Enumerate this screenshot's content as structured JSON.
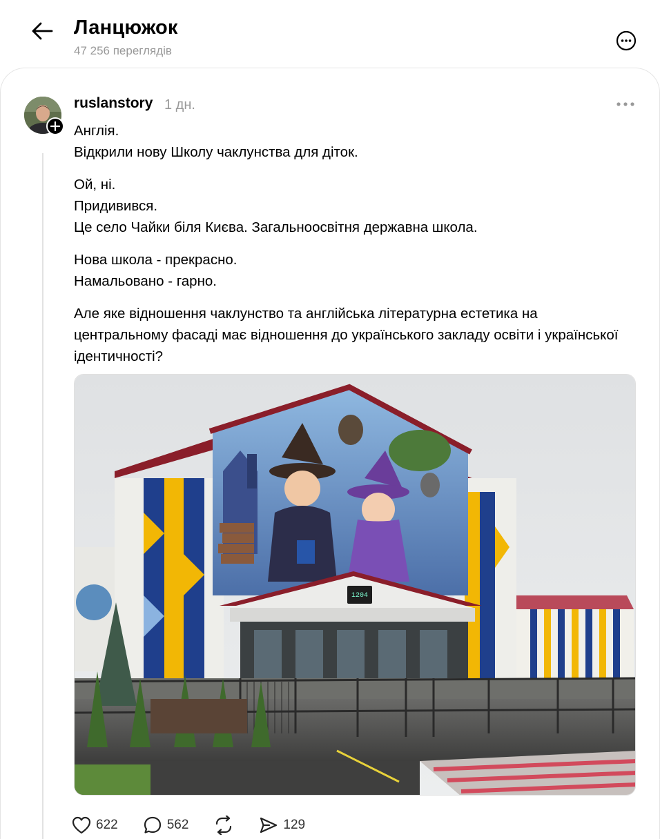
{
  "header": {
    "title": "Ланцюжок",
    "views": "47 256 переглядів"
  },
  "post": {
    "username": "ruslanstory",
    "time": "1 дн.",
    "paragraphs": [
      [
        "Англія.",
        "Відкрили нову Школу чаклунства для діток."
      ],
      [
        "Ой, ні.",
        "Придивився.",
        "Це село Чайки біля Києва. Загальноосвітня державна школа."
      ],
      [
        "Нова школа - прекрасно.",
        "Намальовано - гарно."
      ],
      [
        "Але яке відношення чаклунство та англійська літературна естетика на центральному фасаді має відношення до українського закладу освіти і української ідентичності?"
      ]
    ],
    "photo_display": {
      "clock": "1204"
    },
    "stats": {
      "likes": "622",
      "replies": "562",
      "shares": "129"
    }
  },
  "colors": {
    "muted_text": "#999999",
    "facade_blue": "#1f3f8c",
    "facade_yellow": "#f2b705",
    "roof_red": "#8a1e2a"
  },
  "icons": [
    "back-arrow-icon",
    "more-circle-icon",
    "plus-icon",
    "more-dots-icon",
    "heart-icon",
    "comment-icon",
    "repost-icon",
    "share-icon"
  ]
}
